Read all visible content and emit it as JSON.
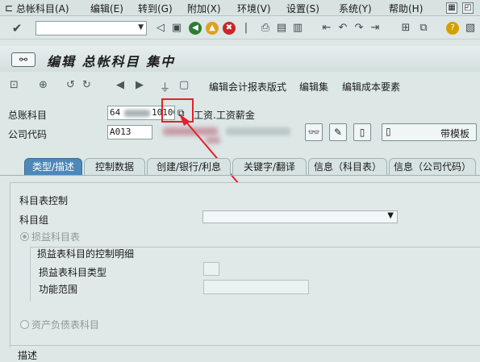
{
  "menubar": {
    "items": [
      "总帐科目(A)",
      "编辑(E)",
      "转到(G)",
      "附加(X)",
      "环境(V)",
      "设置(S)",
      "系统(Y)",
      "帮助(H)"
    ]
  },
  "std_toolbar": {
    "command_field_value": ""
  },
  "title": {
    "text": "编辑 总帐科目 集中"
  },
  "app_toolbar": {
    "buttons": [
      "编辑会计报表版式",
      "编辑集",
      "编辑成本要素"
    ]
  },
  "header_fields": {
    "gl_account_label": "总账科目",
    "gl_account_prefix": "64",
    "gl_account_suffix": "10100",
    "gl_account_desc": "工资.工资薪金",
    "company_code_label": "公司代码",
    "company_code_value": "A013",
    "template_button_label": "带模板"
  },
  "tabs": [
    "类型/描述",
    "控制数据",
    "创建/银行/利息",
    "关键字/翻译",
    "信息（科目表）",
    "信息（公司代码）"
  ],
  "active_tab": 0,
  "content": {
    "section_title": "科目表控制",
    "account_group_label": "科目组",
    "account_group_value": "",
    "pl_radio_label": "损益科目表",
    "pl_group_title": "损益表科目的控制明细",
    "pl_type_label": "损益表科目类型",
    "func_area_label": "功能范围",
    "bs_radio_label": "资产负债表科目",
    "description_label": "描述"
  },
  "colors": {
    "active_tab": "#4d88b8",
    "highlight": "#e0222b"
  }
}
